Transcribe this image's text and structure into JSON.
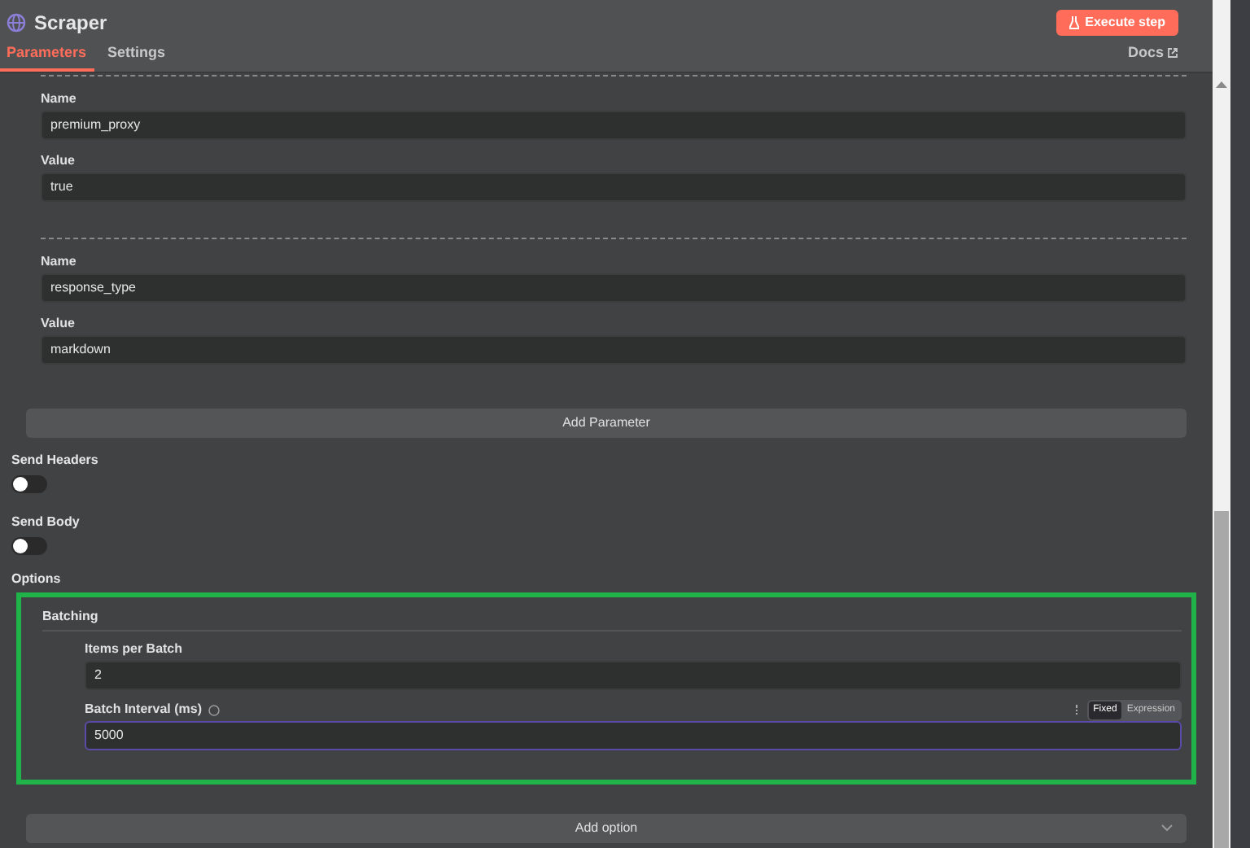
{
  "header": {
    "title": "Scraper",
    "execute_button": "Execute step"
  },
  "tabs": [
    {
      "label": "Parameters",
      "selected": true
    },
    {
      "label": "Settings",
      "selected": false
    }
  ],
  "docs_link": "Docs",
  "parameters": [
    {
      "name_label": "Name",
      "name": "premium_proxy",
      "value_label": "Value",
      "value": "true"
    },
    {
      "name_label": "Name",
      "name": "response_type",
      "value_label": "Value",
      "value": "markdown"
    }
  ],
  "add_parameter": "Add Parameter",
  "toggles": [
    {
      "label": "Send Headers",
      "on": false
    },
    {
      "label": "Send Body",
      "on": false
    }
  ],
  "options": {
    "label": "Options",
    "group_title": "Batching",
    "fields": [
      {
        "label": "Items per Batch",
        "value": "2",
        "focused": false,
        "help": false
      },
      {
        "label": "Batch Interval (ms)",
        "value": "5000",
        "focused": true,
        "help": true,
        "modes": [
          {
            "label": "Fixed",
            "selected": true
          },
          {
            "label": "Expression",
            "selected": false
          }
        ]
      }
    ]
  },
  "add_option": "Add option"
}
